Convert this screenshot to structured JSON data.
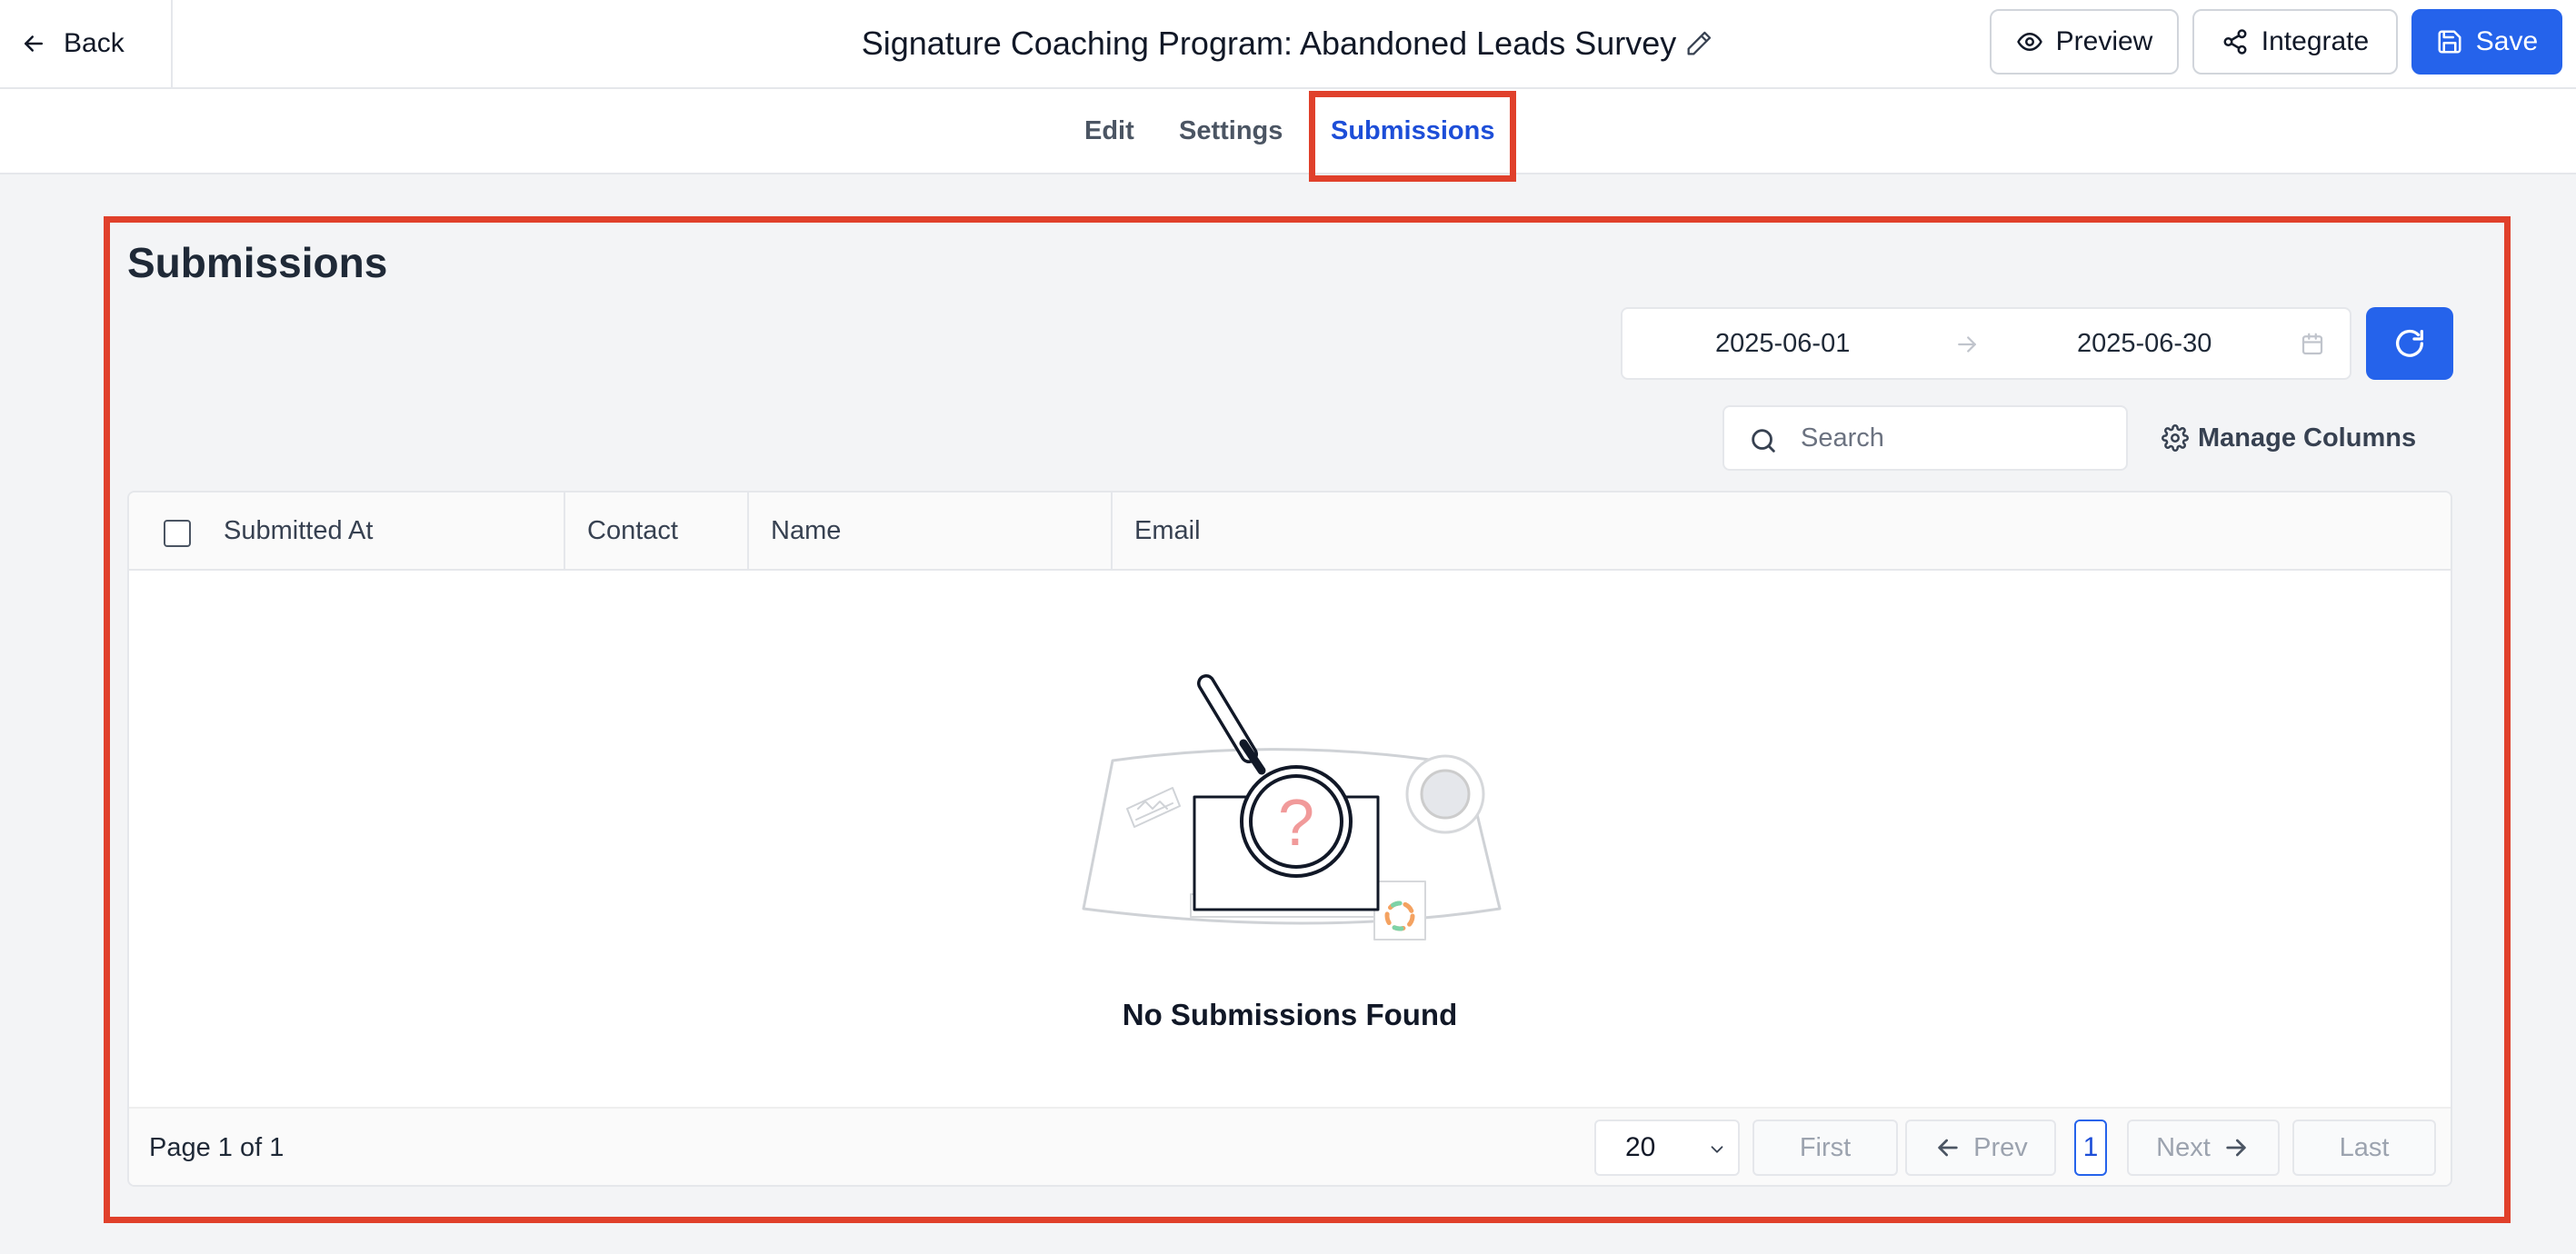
{
  "header": {
    "back_label": "Back",
    "title": "Signature Coaching Program: Abandoned Leads Survey",
    "preview_label": "Preview",
    "integrate_label": "Integrate",
    "save_label": "Save",
    "accent_color": "#2563eb"
  },
  "tabs": [
    {
      "label": "Edit",
      "active": false
    },
    {
      "label": "Settings",
      "active": false
    },
    {
      "label": "Submissions",
      "active": true
    }
  ],
  "main": {
    "heading": "Submissions",
    "date_start": "2025-06-01",
    "date_end": "2025-06-30",
    "search_placeholder": "Search",
    "manage_columns_label": "Manage Columns"
  },
  "table": {
    "columns": [
      "Submitted At",
      "Contact",
      "Name",
      "Email"
    ],
    "rows": [],
    "empty_message": "No Submissions Found"
  },
  "pagination": {
    "page_info": "Page 1 of 1",
    "page_size": "20",
    "first_label": "First",
    "prev_label": "Prev",
    "current_page": "1",
    "next_label": "Next",
    "last_label": "Last"
  },
  "highlight_color": "#e0402b"
}
